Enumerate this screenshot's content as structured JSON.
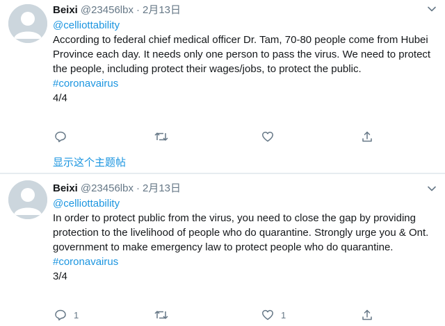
{
  "tweets": [
    {
      "author_name": "Beixi",
      "handle": "@23456lbx",
      "separator": "·",
      "date": "2月13日",
      "mention": "@celliottability",
      "text": "According to federal chief medical officer Dr. Tam, 70-80 people come from Hubei Province each day. It needs only one person to pass the virus. We need to protect the people, including protect their wages/jobs, to protect the public.",
      "hashtag": "#coronavairus",
      "thread_count": "4/4",
      "reply_count": "",
      "retweet_count": "",
      "like_count": "",
      "show_thread_label": "显示这个主题帖"
    },
    {
      "author_name": "Beixi",
      "handle": "@23456lbx",
      "separator": "·",
      "date": "2月13日",
      "mention": "@celliottability",
      "text": "In order to protect public from the virus, you need to close the gap by providing protection to the livelihood of people who do quarantine. Strongly urge you & Ont. government to make emergency law to protect people who do quarantine.",
      "hashtag": "#coronavairus",
      "thread_count": "3/4",
      "reply_count": "1",
      "retweet_count": "",
      "like_count": "1"
    }
  ],
  "icons": {
    "reply": "reply-icon",
    "retweet": "retweet-icon",
    "like": "like-icon",
    "share": "share-icon",
    "menu": "chevron-down-icon",
    "avatar": "default-avatar-icon"
  },
  "colors": {
    "link": "#1b95e0",
    "secondary_text": "#657786",
    "primary_text": "#14171a",
    "avatar_bg": "#ccd6dd",
    "divider": "#e6ecf0"
  }
}
